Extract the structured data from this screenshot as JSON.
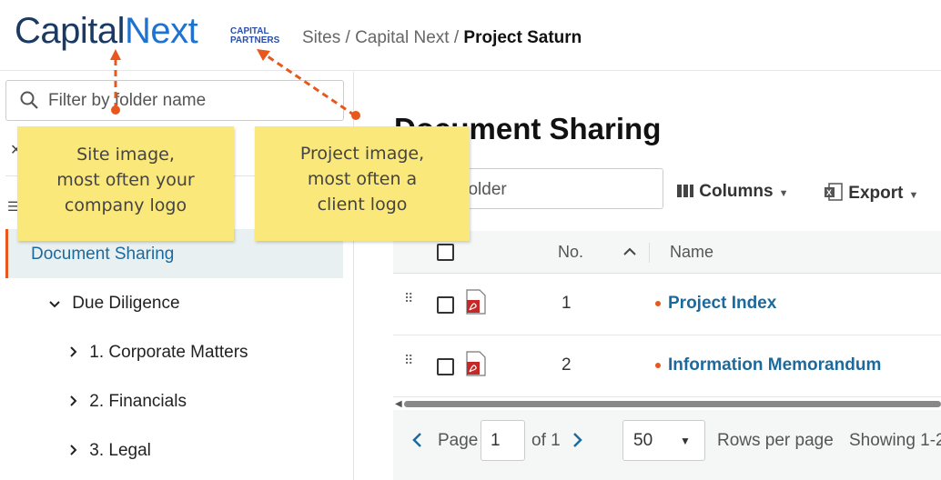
{
  "header": {
    "logo_part1": "Capital",
    "logo_part2": "Next",
    "project_logo_line1": "CAPITAL",
    "project_logo_line2": "PARTNERS",
    "breadcrumb_prefix": "Sites / Capital Next / ",
    "breadcrumb_current": "Project Saturn"
  },
  "sidebar": {
    "filter_placeholder": "Filter by folder name",
    "active_item": "Document Sharing",
    "tree": [
      {
        "label": "Due Diligence",
        "chevron": "⌄"
      },
      {
        "label": "1. Corporate Matters",
        "chevron": "›"
      },
      {
        "label": "2. Financials",
        "chevron": "›"
      },
      {
        "label": "3. Legal",
        "chevron": "›"
      }
    ]
  },
  "main": {
    "title": "Document Sharing",
    "search_placeholder": "ch this folder",
    "columns_label": "Columns",
    "export_label": "Export",
    "table": {
      "col_no": "No.",
      "col_name": "Name",
      "rows": [
        {
          "no": "1",
          "name": "Project Index",
          "type": "pdf"
        },
        {
          "no": "2",
          "name": "Information Memorandum",
          "type": "pdf"
        }
      ]
    },
    "pager": {
      "page_label": "Page",
      "page_value": "1",
      "of_label": "of 1",
      "rows_value": "50",
      "rows_per_page_label": "Rows per page",
      "showing_label": "Showing 1-2"
    }
  },
  "annotations": {
    "site_note": [
      "Site image,",
      "most often your",
      "company logo"
    ],
    "project_note": [
      "Project image,",
      "most often a",
      "client logo"
    ],
    "arrow_color": "#e8571e",
    "note_color": "#fbe87a"
  },
  "colors": {
    "accent": "#e8571e",
    "link": "#1b6a9e",
    "logo_dark": "#1b3a63",
    "logo_light": "#1e73d1"
  }
}
